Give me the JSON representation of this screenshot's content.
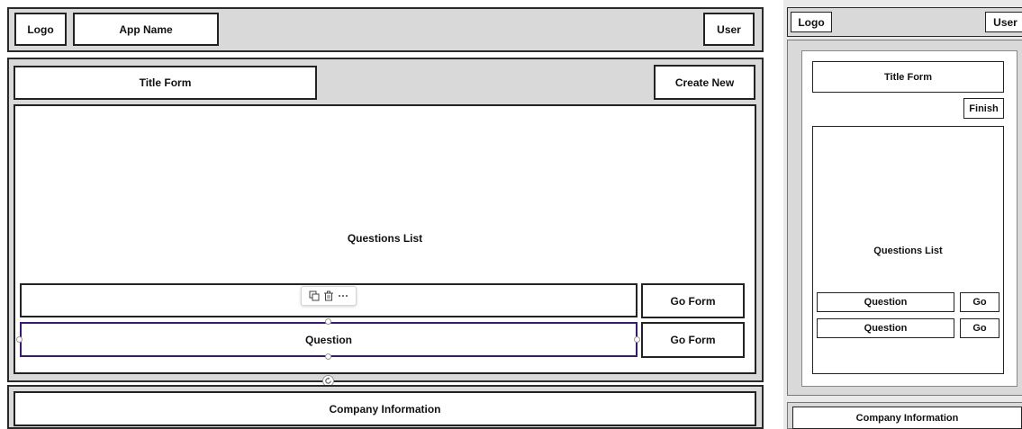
{
  "desktop": {
    "header": {
      "logo": "Logo",
      "app_name": "App Name",
      "user": "User"
    },
    "main": {
      "title_form": "Title Form",
      "create_new": "Create New",
      "questions_list": "Questions List",
      "rows": [
        {
          "question": "",
          "action": "Go Form"
        },
        {
          "question": "Question",
          "action": "Go Form"
        }
      ]
    },
    "footer": {
      "company_info": "Company Information"
    }
  },
  "mobile": {
    "header": {
      "logo": "Logo",
      "user": "User"
    },
    "main": {
      "title_form": "Title Form",
      "finish": "Finish",
      "questions_list": "Questions List",
      "rows": [
        {
          "question": "Question",
          "action": "Go"
        },
        {
          "question": "Question",
          "action": "Go"
        }
      ]
    },
    "footer": {
      "company_info": "Company Information"
    }
  },
  "icons": [
    "copy-icon",
    "trash-icon",
    "more-icon",
    "rotate-icon"
  ]
}
